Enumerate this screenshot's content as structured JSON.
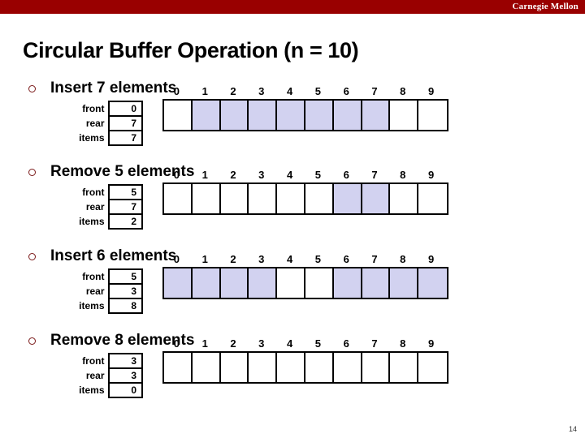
{
  "brand": {
    "label": "Carnegie Mellon",
    "bar_color": "#990000"
  },
  "title": "Circular Buffer Operation (n = 10)",
  "page_number": "14",
  "colors": {
    "filled_cell": "#d2d2f0",
    "cell_border": "#000000",
    "bullet": "#7b1a1a"
  },
  "labels": {
    "front": "front",
    "rear": "rear",
    "items": "items"
  },
  "indices": [
    "0",
    "1",
    "2",
    "3",
    "4",
    "5",
    "6",
    "7",
    "8",
    "9"
  ],
  "sections": [
    {
      "heading": "Insert 7 elements",
      "front": "0",
      "rear": "7",
      "items": "7",
      "cells": [
        false,
        true,
        true,
        true,
        true,
        true,
        true,
        true,
        false,
        false
      ]
    },
    {
      "heading": "Remove 5 elements",
      "front": "5",
      "rear": "7",
      "items": "2",
      "cells": [
        false,
        false,
        false,
        false,
        false,
        false,
        true,
        true,
        false,
        false
      ]
    },
    {
      "heading": "Insert 6 elements",
      "front": "5",
      "rear": "3",
      "items": "8",
      "cells": [
        true,
        true,
        true,
        true,
        false,
        false,
        true,
        true,
        true,
        true
      ]
    },
    {
      "heading": "Remove 8 elements",
      "front": "3",
      "rear": "3",
      "items": "0",
      "cells": [
        false,
        false,
        false,
        false,
        false,
        false,
        false,
        false,
        false,
        false
      ]
    }
  ]
}
